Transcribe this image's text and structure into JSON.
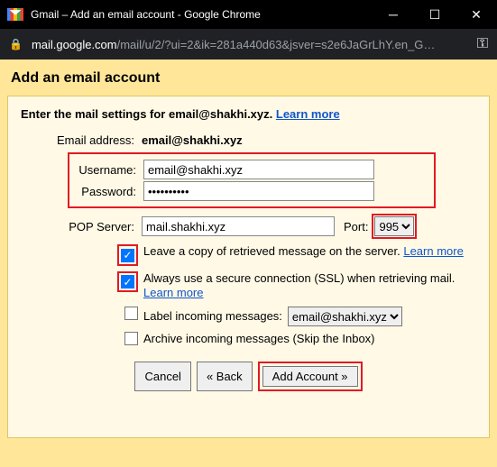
{
  "window": {
    "title": "Gmail – Add an email account - Google Chrome"
  },
  "addressbar": {
    "host": "mail.google.com",
    "path": "/mail/u/2/?ui=2&ik=281a440d63&jsver=s2e6JaGrLhY.en_G…"
  },
  "page": {
    "heading": "Add an email account",
    "intro_prefix": "Enter the mail settings for email@shakhi.xyz. ",
    "learn_more": "Learn more",
    "email_label": "Email address:",
    "email_value": "email@shakhi.xyz",
    "username_label": "Username:",
    "username_value": "email@shakhi.xyz",
    "password_label": "Password:",
    "password_value": "••••••••••",
    "pop_label": "POP Server:",
    "pop_value": "mail.shakhi.xyz",
    "port_label": "Port:",
    "port_value": "995",
    "opt_leave_copy": "Leave a copy of retrieved message on the server. ",
    "opt_ssl": "Always use a secure connection (SSL) when retrieving mail.",
    "opt_label_incoming": "Label incoming messages:",
    "label_select_value": "email@shakhi.xyz",
    "opt_archive": "Archive incoming messages (Skip the Inbox)",
    "btn_cancel": "Cancel",
    "btn_back": "« Back",
    "btn_add": "Add Account »"
  }
}
